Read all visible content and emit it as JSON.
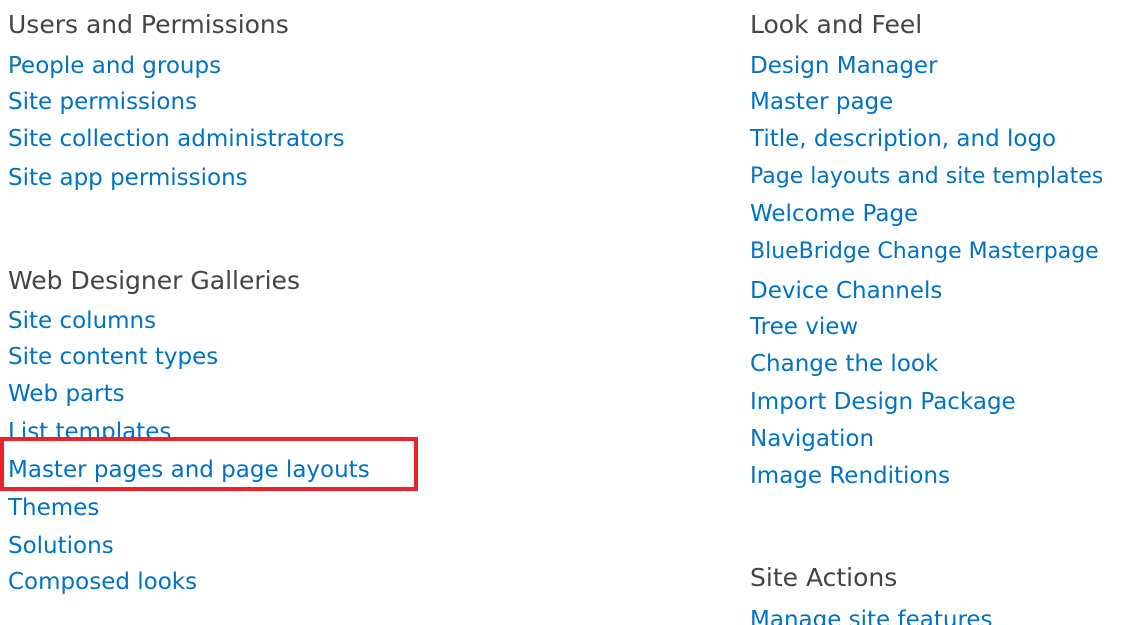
{
  "left_column": {
    "users_permissions": {
      "heading": "Users and Permissions",
      "links": [
        "People and groups",
        "Site permissions",
        "Site collection administrators",
        "Site app permissions"
      ]
    },
    "web_designer_galleries": {
      "heading": "Web Designer Galleries",
      "links": [
        "Site columns",
        "Site content types",
        "Web parts",
        "List templates",
        "Master pages and page layouts",
        "Themes",
        "Solutions",
        "Composed looks"
      ]
    }
  },
  "right_column": {
    "look_and_feel": {
      "heading": "Look and Feel",
      "links": [
        "Design Manager",
        "Master page",
        "Title, description, and logo",
        "Page layouts and site templates",
        "Welcome Page",
        "BlueBridge Change Masterpage",
        "Device Channels",
        "Tree view",
        "Change the look",
        "Import Design Package",
        "Navigation",
        "Image Renditions"
      ]
    },
    "site_actions": {
      "heading": "Site Actions",
      "links": [
        "Manage site features"
      ]
    }
  },
  "colors": {
    "link": "#0072c6",
    "heading": "#444444",
    "highlight": "#e8232a"
  }
}
